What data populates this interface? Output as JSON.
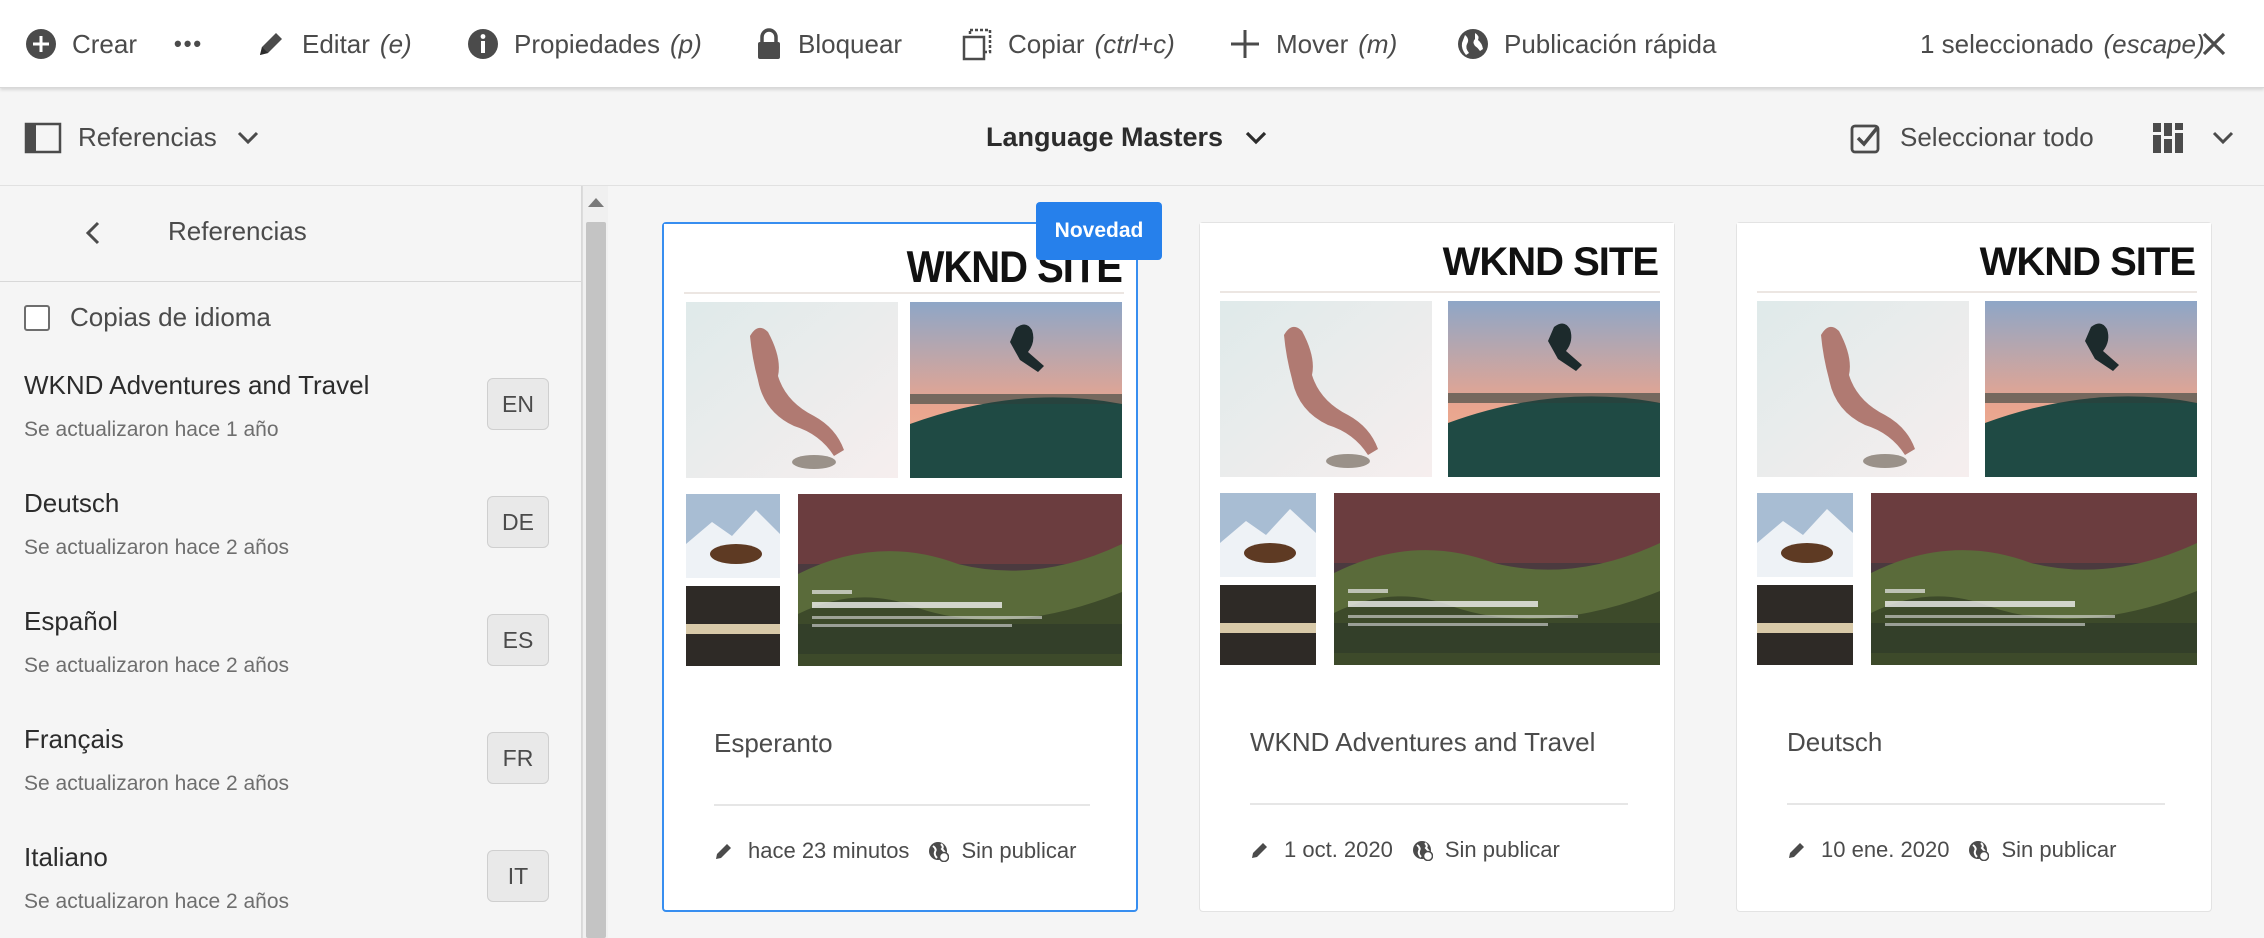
{
  "actionbar": {
    "create": "Crear",
    "more": "•••",
    "edit": "Editar",
    "edit_key": "(e)",
    "properties": "Propiedades",
    "properties_key": "(p)",
    "lock": "Bloquear",
    "copy": "Copiar",
    "copy_key": "(ctrl+c)",
    "move": "Mover",
    "move_key": "(m)",
    "quick_publish": "Publicación rápida",
    "selection_count": "1 seleccionado",
    "selection_key": "(escape)"
  },
  "toolbar": {
    "rail_label": "Referencias",
    "title": "Language Masters",
    "select_all": "Seleccionar todo"
  },
  "rail": {
    "title": "Referencias",
    "language_copies": "Copias de idioma",
    "items": [
      {
        "title": "WKND Adventures and Travel",
        "subtitle": "Se actualizaron hace 1 año",
        "code": "EN"
      },
      {
        "title": "Deutsch",
        "subtitle": "Se actualizaron hace 2 años",
        "code": "DE"
      },
      {
        "title": "Español",
        "subtitle": "Se actualizaron hace 2 años",
        "code": "ES"
      },
      {
        "title": "Français",
        "subtitle": "Se actualizaron hace 2 años",
        "code": "FR"
      },
      {
        "title": "Italiano",
        "subtitle": "Se actualizaron hace 2 años",
        "code": "IT"
      }
    ]
  },
  "cards": [
    {
      "title": "Esperanto",
      "modified": "hace 23 minutos",
      "status": "Sin publicar",
      "badge": "Novedad",
      "selected": true,
      "thumb_logo": "WKND SITE"
    },
    {
      "title": "WKND Adventures and Travel",
      "modified": "1 oct. 2020",
      "status": "Sin publicar",
      "selected": false,
      "thumb_logo": "WKND SITE"
    },
    {
      "title": "Deutsch",
      "modified": "10 ene. 2020",
      "status": "Sin publicar",
      "selected": false,
      "thumb_logo": "WKND SITE"
    }
  ],
  "colors": {
    "accent": "#2680eb",
    "selection_border": "#378ef0",
    "text": "#2c2c2c"
  }
}
